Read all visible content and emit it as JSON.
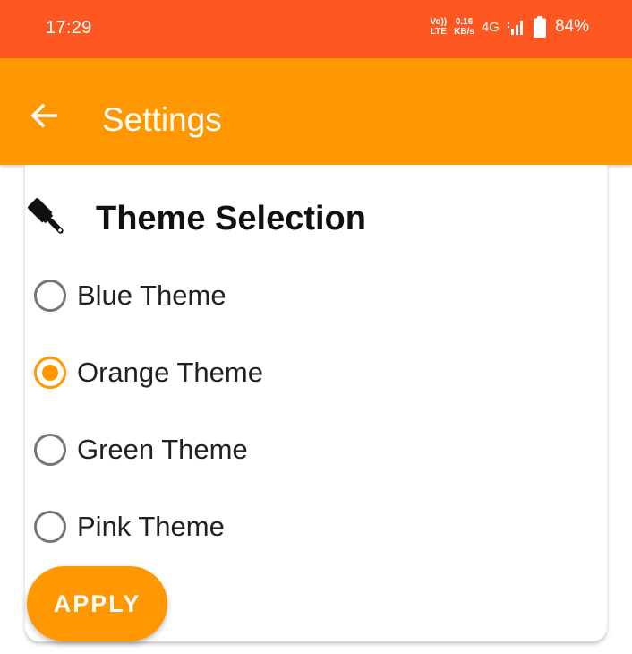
{
  "status_bar": {
    "time": "17:29",
    "volte_top": "Vo))",
    "volte_bottom": "LTE",
    "speed_value": "0.16",
    "speed_unit": "KB/s",
    "network": "4G",
    "battery": "84%",
    "color": "#FF5722"
  },
  "app_bar": {
    "title": "Settings",
    "back_icon": "arrow-left-icon",
    "color": "#FF9800"
  },
  "section": {
    "icon": "paint-brush-icon",
    "title": "Theme Selection"
  },
  "themes": [
    {
      "label": "Blue Theme",
      "checked": false
    },
    {
      "label": "Orange Theme",
      "checked": true
    },
    {
      "label": "Green Theme",
      "checked": false
    },
    {
      "label": "Pink Theme",
      "checked": false
    }
  ],
  "apply_button": {
    "label": "APPLY",
    "color": "#FF9800"
  }
}
